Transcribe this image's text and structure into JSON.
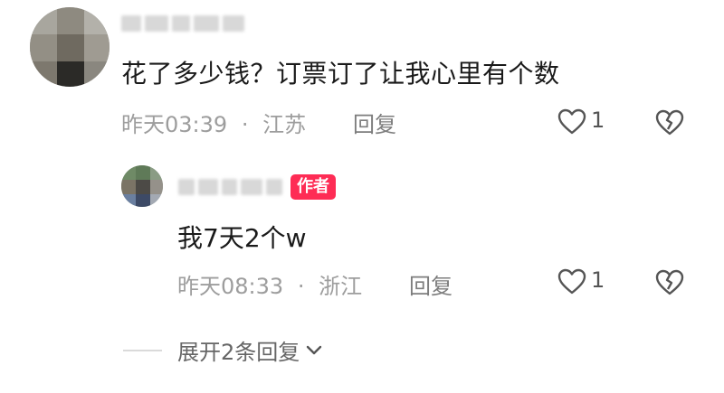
{
  "comment": {
    "text": "花了多少钱？订票订了让我心里有个数",
    "time": "昨天03:39",
    "separator": "·",
    "location": "江苏",
    "reply_label": "回复",
    "like_count": "1"
  },
  "reply": {
    "author_badge": "作者",
    "text": "我7天2个w",
    "time": "昨天08:33",
    "separator": "·",
    "location": "浙江",
    "reply_label": "回复",
    "like_count": "1"
  },
  "expand_replies_label": "展开2条回复",
  "colors": {
    "badge": "#fe2c55",
    "meta_text": "#9d9d9d",
    "body_text": "#1a1a1a"
  },
  "icons": [
    "heart-icon",
    "broken-heart-icon",
    "chevron-down-icon"
  ]
}
